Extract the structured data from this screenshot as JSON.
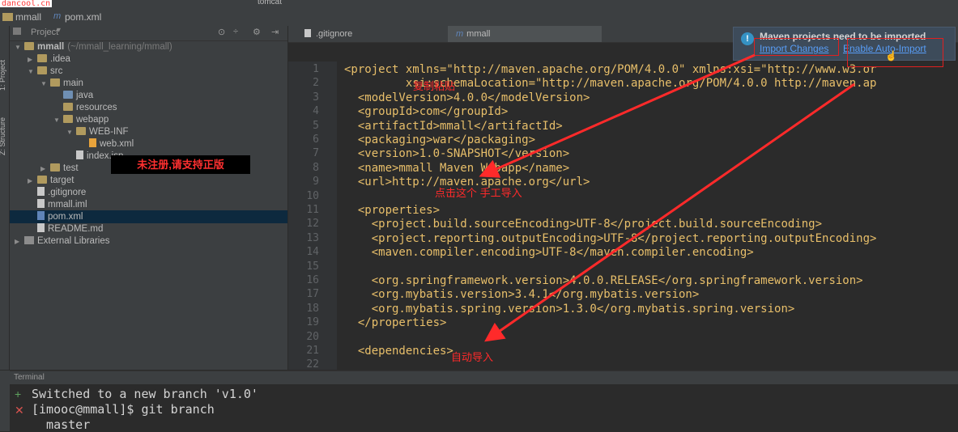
{
  "watermark": "dancool.cn",
  "breadcrumb": {
    "project": "mmall",
    "file": "pom.xml"
  },
  "toolbar": {
    "run_config": "tomcat"
  },
  "left_tabs": {
    "project": "1: Project",
    "structure": "Z: Structure"
  },
  "project_panel": {
    "title": "Project",
    "tree": [
      {
        "label": "mmall",
        "sub": "(~/mmall_learning/mmall)",
        "indent": 0,
        "arrow": "down",
        "icon": "folder"
      },
      {
        "label": ".idea",
        "indent": 1,
        "arrow": "right",
        "icon": "folder"
      },
      {
        "label": "src",
        "indent": 1,
        "arrow": "down",
        "icon": "folder"
      },
      {
        "label": "main",
        "indent": 2,
        "arrow": "down",
        "icon": "folder"
      },
      {
        "label": "java",
        "indent": 3,
        "arrow": "",
        "icon": "srcfolder"
      },
      {
        "label": "resources",
        "indent": 3,
        "arrow": "",
        "icon": "folder"
      },
      {
        "label": "webapp",
        "indent": 3,
        "arrow": "down",
        "icon": "folder"
      },
      {
        "label": "WEB-INF",
        "indent": 4,
        "arrow": "down",
        "icon": "folder"
      },
      {
        "label": "web.xml",
        "indent": 5,
        "arrow": "",
        "icon": "xmlfile"
      },
      {
        "label": "index.jsp",
        "indent": 4,
        "arrow": "",
        "icon": "file"
      },
      {
        "label": "test",
        "indent": 2,
        "arrow": "right",
        "icon": "folder"
      },
      {
        "label": "target",
        "indent": 1,
        "arrow": "right",
        "icon": "folder"
      },
      {
        "label": ".gitignore",
        "indent": 1,
        "arrow": "",
        "icon": "file"
      },
      {
        "label": "mmall.iml",
        "indent": 1,
        "arrow": "",
        "icon": "file"
      },
      {
        "label": "pom.xml",
        "indent": 1,
        "arrow": "",
        "icon": "mfile"
      },
      {
        "label": "README.md",
        "indent": 1,
        "arrow": "",
        "icon": "file"
      },
      {
        "label": "External Libraries",
        "indent": 0,
        "arrow": "right",
        "icon": "libicon"
      }
    ]
  },
  "editor_tabs": [
    ".gitignore",
    "mmall"
  ],
  "code_lines": [
    {
      "n": "1",
      "text": "<project xmlns=\"http://maven.apache.org/POM/4.0.0\" xmlns:xsi=\"http://www.w3.or"
    },
    {
      "n": "2",
      "text": "         xsi:schemaLocation=\"http://maven.apache.org/POM/4.0.0 http://maven.ap"
    },
    {
      "n": "3",
      "text": "  <modelVersion>4.0.0</modelVersion>"
    },
    {
      "n": "4",
      "text": "  <groupId>com</groupId>"
    },
    {
      "n": "5",
      "text": "  <artifactId>mmall</artifactId>"
    },
    {
      "n": "6",
      "text": "  <packaging>war</packaging>"
    },
    {
      "n": "7",
      "text": "  <version>1.0-SNAPSHOT</version>"
    },
    {
      "n": "8",
      "text": "  <name>mmall Maven Webapp</name>"
    },
    {
      "n": "9",
      "text": "  <url>http://maven.apache.org</url>"
    },
    {
      "n": "10",
      "text": ""
    },
    {
      "n": "11",
      "text": "  <properties>"
    },
    {
      "n": "12",
      "text": "    <project.build.sourceEncoding>UTF-8</project.build.sourceEncoding>"
    },
    {
      "n": "13",
      "text": "    <project.reporting.outputEncoding>UTF-8</project.reporting.outputEncoding>"
    },
    {
      "n": "14",
      "text": "    <maven.compiler.encoding>UTF-8</maven.compiler.encoding>"
    },
    {
      "n": "15",
      "text": ""
    },
    {
      "n": "16",
      "text": "    <org.springframework.version>4.0.0.RELEASE</org.springframework.version>"
    },
    {
      "n": "17",
      "text": "    <org.mybatis.version>3.4.1</org.mybatis.version>"
    },
    {
      "n": "18",
      "text": "    <org.mybatis.spring.version>1.3.0</org.mybatis.spring.version>"
    },
    {
      "n": "19",
      "text": "  </properties>"
    },
    {
      "n": "20",
      "text": ""
    },
    {
      "n": "21",
      "text": "  <dependencies>"
    },
    {
      "n": "22",
      "text": ""
    }
  ],
  "notification": {
    "title": "Maven projects need to be imported",
    "import_changes": "Import Changes",
    "enable_auto_import": "Enable Auto-Import"
  },
  "annotations": {
    "copy_paste": "复制粘贴",
    "click_manual": "点击这个  手工导入",
    "auto_import": "自动导入",
    "unregistered": "未注册,请支持正版"
  },
  "terminal": {
    "title": "Terminal",
    "lines": [
      "Switched to a new branch 'v1.0'",
      "[imooc@mmall]$ git branch",
      "  master"
    ]
  },
  "colors": {
    "annotation_red": "#ff2a2a",
    "link_blue": "#589df6",
    "xml_tag": "#e8bf6a",
    "xml_value": "#6a8759"
  }
}
